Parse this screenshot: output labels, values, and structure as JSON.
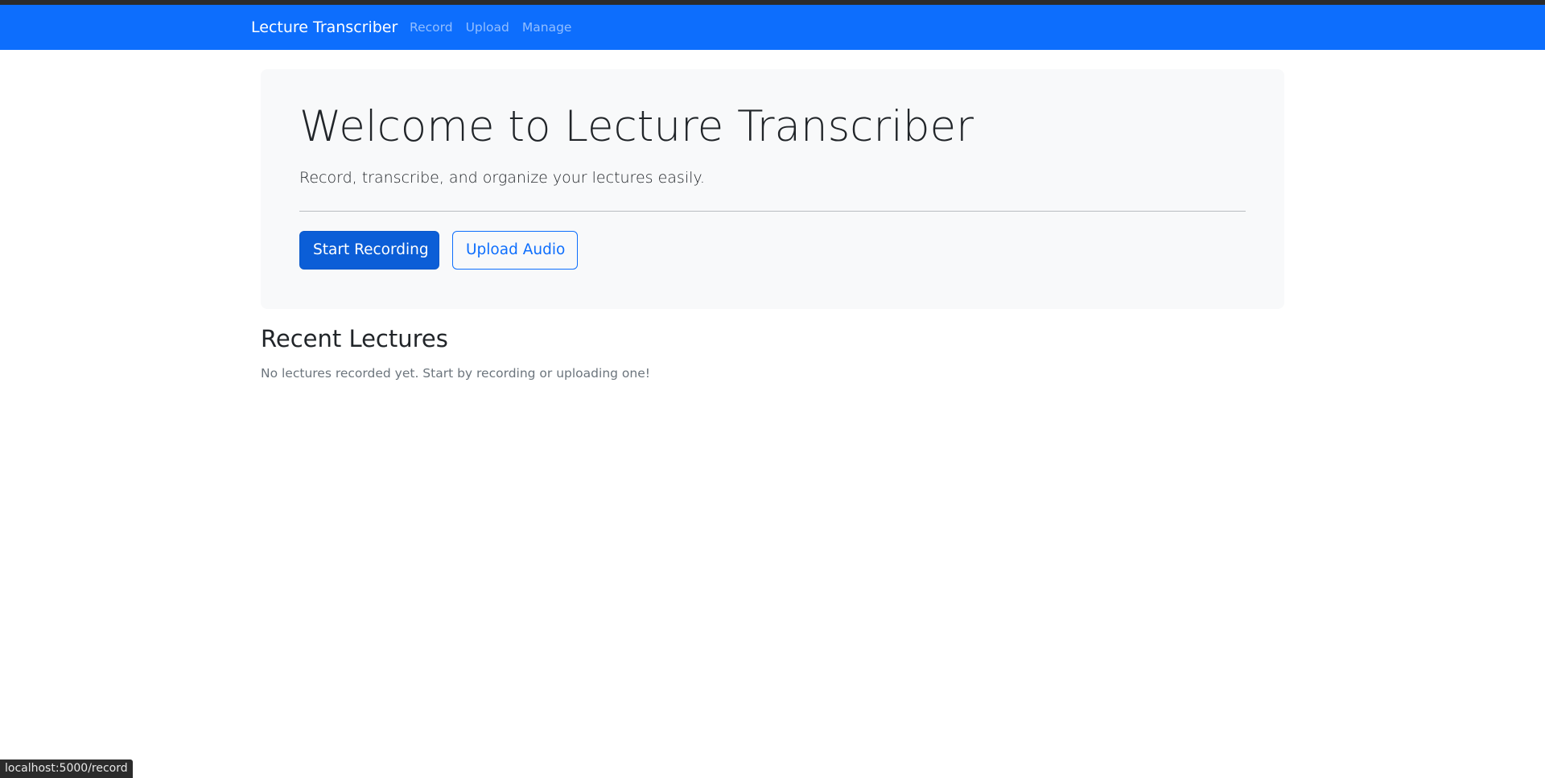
{
  "navbar": {
    "brand": "Lecture Transcriber",
    "links": [
      {
        "label": "Record"
      },
      {
        "label": "Upload"
      },
      {
        "label": "Manage"
      }
    ]
  },
  "hero": {
    "title": "Welcome to Lecture Transcriber",
    "lead": "Record, transcribe, and organize your lectures easily.",
    "primary_button": "Start Recording",
    "secondary_button": "Upload Audio"
  },
  "recent": {
    "heading": "Recent Lectures",
    "empty_message": "No lectures recorded yet. Start by recording or uploading one!"
  },
  "status_bar": {
    "url": "localhost:5000/record"
  },
  "colors": {
    "navbar": "#0d6efd",
    "primary": "#0b5ed7",
    "hero_background": "#f8f9fa"
  }
}
